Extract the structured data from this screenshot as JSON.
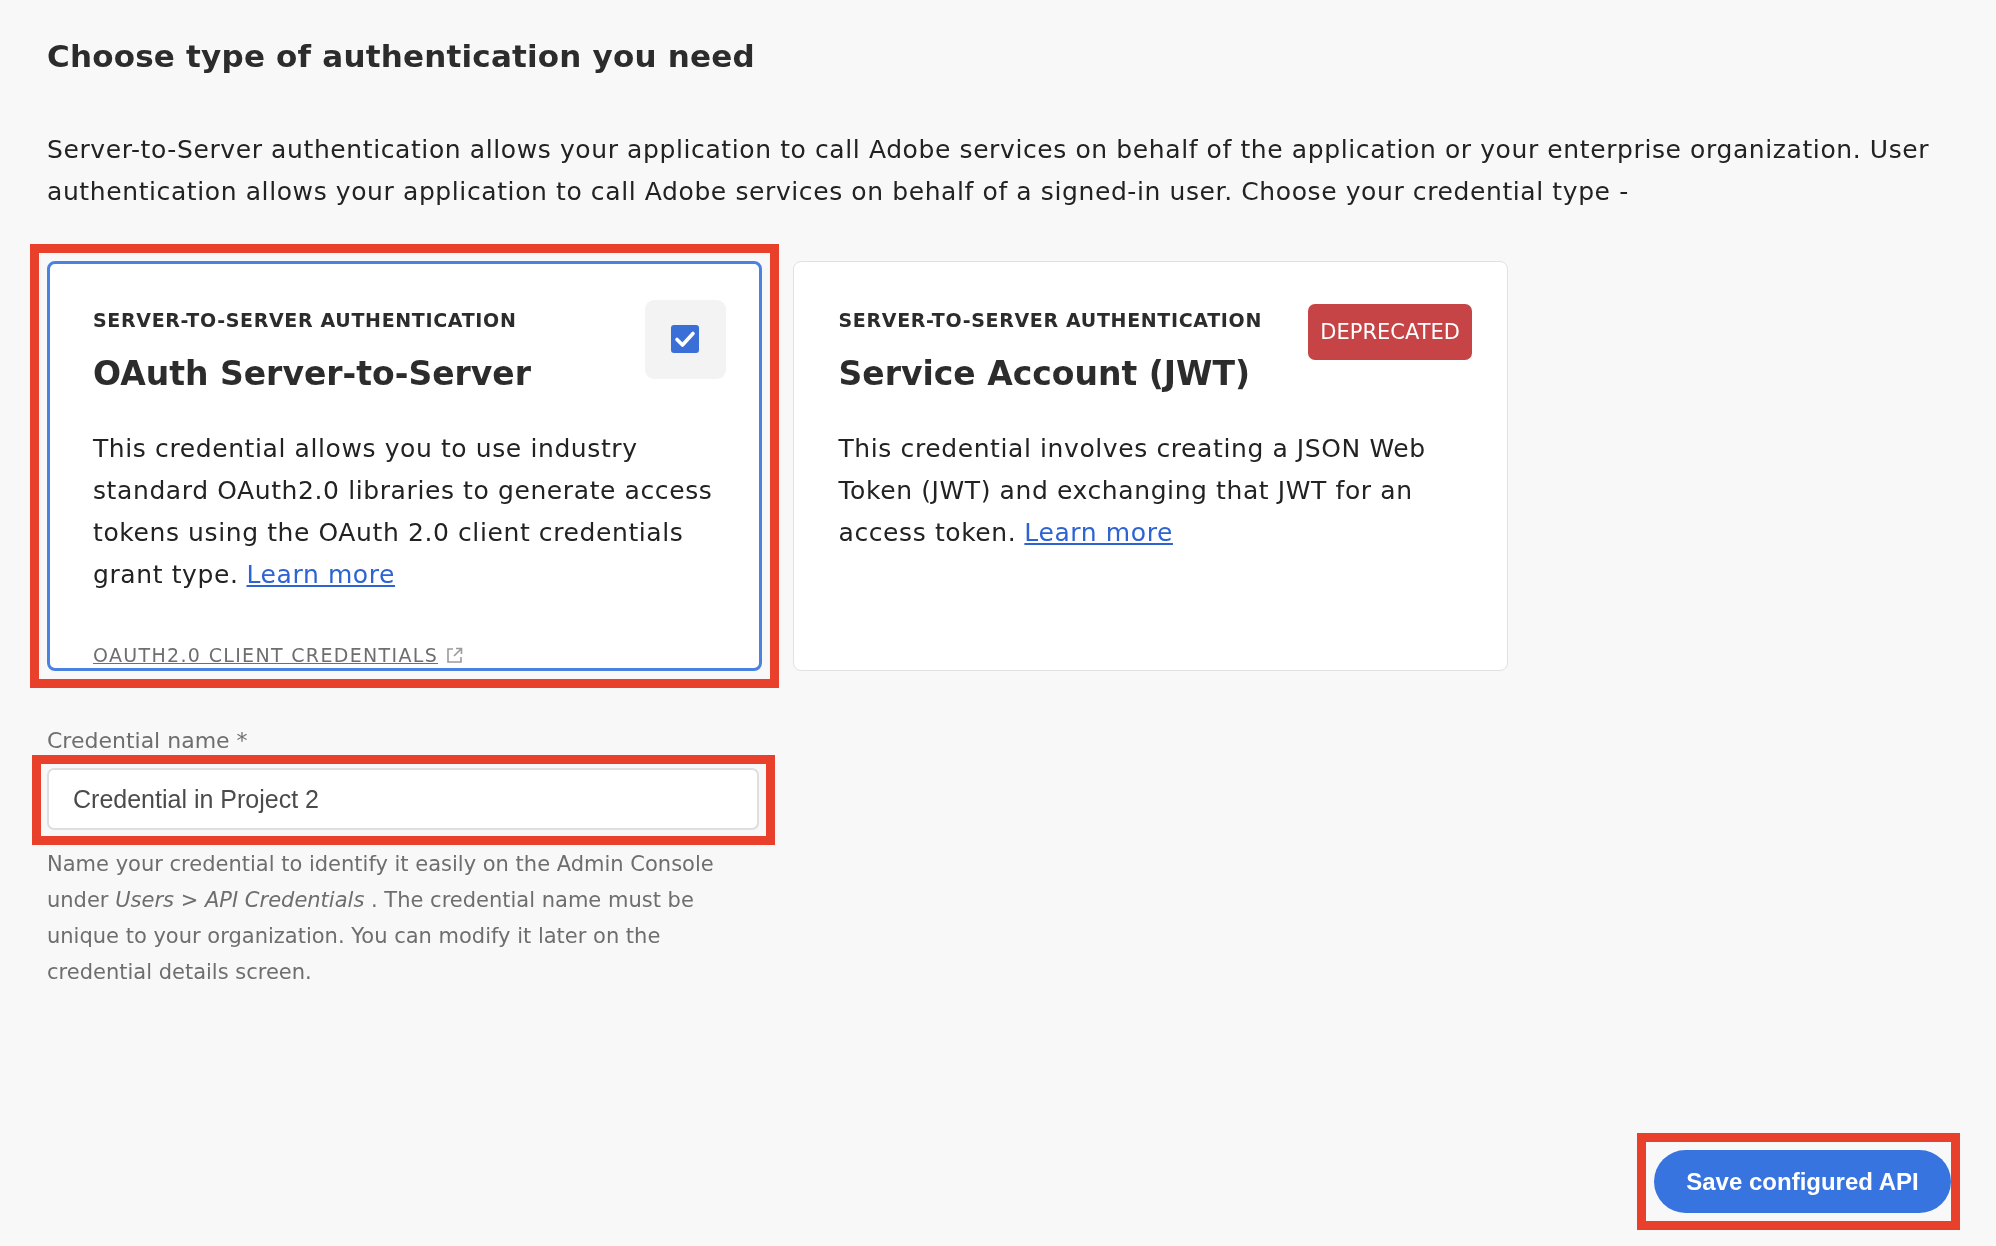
{
  "heading": "Choose type of authentication you need",
  "intro": "Server-to-Server authentication allows your application to call Adobe services on behalf of the application or your enterprise organization. User authentication allows your application to call Adobe services on behalf of a signed-in user. Choose your credential type -",
  "credential_types": [
    {
      "eyebrow": "SERVER-TO-SERVER AUTHENTICATION",
      "title": "OAuth Server-to-Server",
      "description": "This credential allows you to use industry standard OAuth2.0 libraries to generate access tokens using the OAuth 2.0 client credentials grant type.",
      "link": "Learn more",
      "footer_link": "OAUTH2.0 CLIENT CREDENTIALS",
      "selected": true,
      "highlighted": true
    },
    {
      "eyebrow": "SERVER-TO-SERVER AUTHENTICATION",
      "badge": "DEPRECATED",
      "title": "Service Account (JWT)",
      "description": "This credential involves creating a JSON Web Token (JWT) and exchanging that JWT for an access token.",
      "link": "Learn more",
      "selected": false,
      "highlighted": false
    }
  ],
  "credential_name": {
    "label": "Credential name *",
    "value": "Credential in Project 2",
    "highlighted": true,
    "help": "Name your credential to identify it easily on the Admin Console under *Users > API Credentials* . The credential name must be unique to your organization. You can modify it later on the credential details screen."
  },
  "save_button": {
    "label": "Save configured API",
    "highlighted": true
  }
}
